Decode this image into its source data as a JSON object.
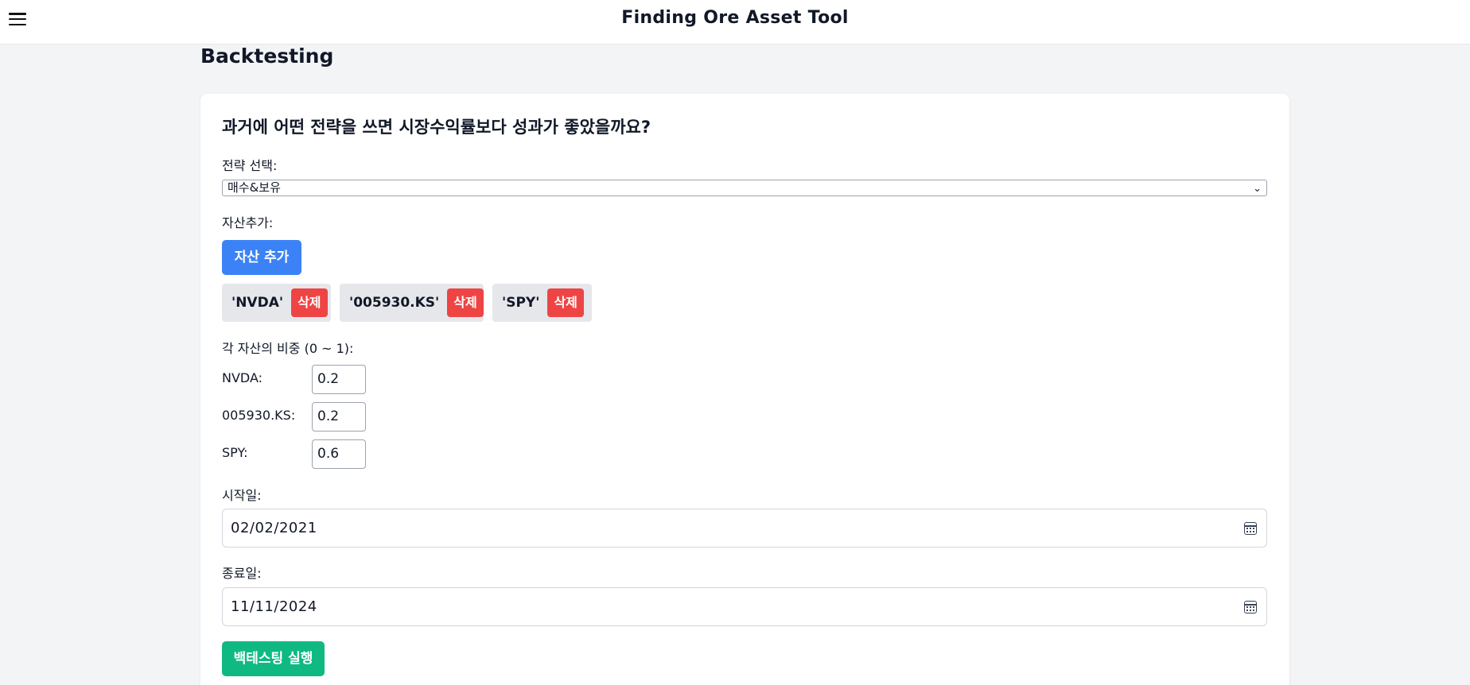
{
  "header": {
    "title": "Finding Ore Asset Tool"
  },
  "page": {
    "heading": "Backtesting"
  },
  "form": {
    "question": "과거에 어떤 전략을 쓰면 시장수익률보다 성과가 좋았을까요?",
    "strategy_label": "전략 선택:",
    "strategy_value": "매수&보유",
    "add_asset_label": "자산추가:",
    "add_asset_button": "자산 추가",
    "assets": [
      {
        "name": "'NVDA'",
        "delete_label": "삭제"
      },
      {
        "name": "'005930.KS'",
        "delete_label": "삭제"
      },
      {
        "name": "'SPY'",
        "delete_label": "삭제"
      }
    ],
    "weights_label": "각 자산의 비중 (0 ~ 1):",
    "weights": [
      {
        "label": "NVDA:",
        "value": "0.2"
      },
      {
        "label": "005930.KS:",
        "value": "0.2"
      },
      {
        "label": "SPY:",
        "value": "0.6"
      }
    ],
    "start_label": "시작일:",
    "start_value": "02/02/2021",
    "end_label": "종료일:",
    "end_value": "11/11/2024",
    "run_button": "백테스팅 실행"
  },
  "colors": {
    "primary": "#3b82f6",
    "danger": "#ef4444",
    "success": "#10b981",
    "background": "#f3f4f6"
  }
}
